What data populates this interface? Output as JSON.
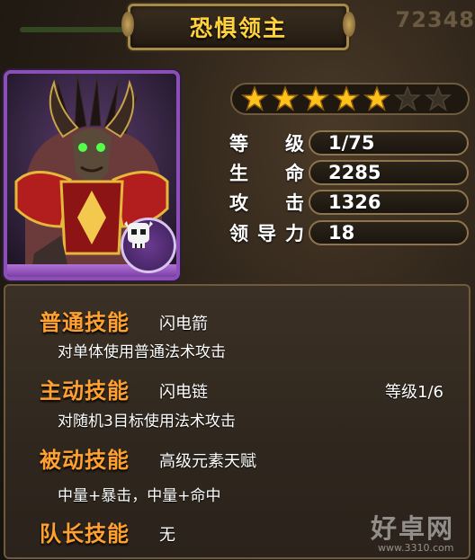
{
  "header": {
    "title": "恐惧领主",
    "bg_number": "72348"
  },
  "hero": {
    "portrait_icon": "demon-lord-portrait",
    "class_icon": "skull-mask-icon",
    "stars_total": 7,
    "stars_filled": 5
  },
  "stats": [
    {
      "label": [
        "等",
        "级"
      ],
      "value": "1/75"
    },
    {
      "label": [
        "生",
        "命"
      ],
      "value": "2285"
    },
    {
      "label": [
        "攻",
        "击"
      ],
      "value": "1326"
    },
    {
      "label": [
        "领",
        "导",
        "力"
      ],
      "value": "18"
    }
  ],
  "skills": {
    "normal": {
      "title": "普通技能",
      "name": "闪电箭",
      "desc": "对单体使用普通法术攻击"
    },
    "active": {
      "title": "主动技能",
      "name": "闪电链",
      "level": "等级1/6",
      "desc": "对随机3目标使用法术攻击"
    },
    "passive": {
      "title": "被动技能",
      "name": "高级元素天赋",
      "desc": "中量+暴击，中量+命中"
    },
    "leader": {
      "title": "队长技能",
      "name": "无"
    }
  },
  "watermark": {
    "text": "好卓网",
    "url": "www.3310.com"
  },
  "colors": {
    "title": "#ffd23e",
    "skill_title": "#ffa030",
    "card_border": "#8c4fb5",
    "star_gold": "#ffc21a"
  }
}
